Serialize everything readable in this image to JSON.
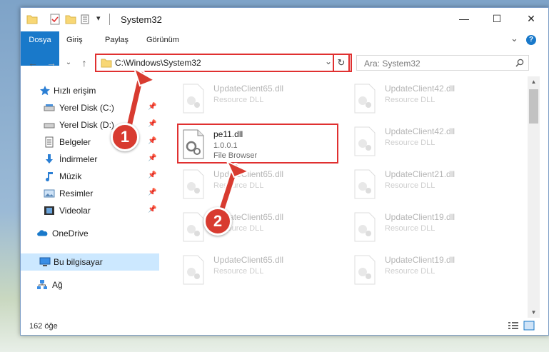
{
  "window": {
    "title": "System32",
    "quick_access_toolbar_arrow": "▾",
    "controls": {
      "minimize": "—",
      "maximize": "☐",
      "close": "✕"
    }
  },
  "ribbon": {
    "tabs": [
      "Dosya",
      "Giriş",
      "Paylaş",
      "Görünüm"
    ],
    "expand": "⌄",
    "help": "?"
  },
  "navigation": {
    "back": "←",
    "forward": "→",
    "recent": "⌄",
    "up": "↑",
    "address": "C:\\Windows\\System32",
    "address_dropdown": "⌄",
    "refresh": "↻",
    "search_placeholder": "Ara: System32"
  },
  "sidebar": {
    "items": [
      {
        "label": "Hızlı erişim",
        "icon": "star-icon",
        "pinned": false
      },
      {
        "label": "Yerel Disk (C:)",
        "icon": "drive-icon",
        "pinned": true
      },
      {
        "label": "Yerel Disk (D:)",
        "icon": "drive-icon",
        "pinned": true
      },
      {
        "label": "Belgeler",
        "icon": "documents-icon",
        "pinned": true
      },
      {
        "label": "İndirmeler",
        "icon": "downloads-icon",
        "pinned": true
      },
      {
        "label": "Müzik",
        "icon": "music-icon",
        "pinned": true
      },
      {
        "label": "Resimler",
        "icon": "pictures-icon",
        "pinned": true
      },
      {
        "label": "Videolar",
        "icon": "videos-icon",
        "pinned": true
      },
      {
        "label": "OneDrive",
        "icon": "cloud-icon",
        "pinned": false
      },
      {
        "label": "Bu bilgisayar",
        "icon": "computer-icon",
        "pinned": false,
        "selected": true
      },
      {
        "label": "Ağ",
        "icon": "network-icon",
        "pinned": false
      }
    ]
  },
  "files": {
    "highlighted": {
      "name": "pe11.dll",
      "version": "1.0.0.1",
      "description": "File Browser"
    },
    "left_column": [
      {
        "name": "UpdateClient65.dll",
        "description": "Resource DLL"
      },
      {
        "name": "UpdateClient65.dll",
        "description": "Resource DLL"
      },
      {
        "name": "UpdateClient65.dll",
        "description": "Resource DLL"
      },
      {
        "name": "UpdateClient65.dll",
        "description": "Resource DLL"
      }
    ],
    "right_column": [
      {
        "name": "UpdateClient42.dll",
        "description": "Resource DLL"
      },
      {
        "name": "UpdateClient42.dll",
        "description": "Resource DLL"
      },
      {
        "name": "UpdateClient21.dll",
        "description": "Resource DLL"
      },
      {
        "name": "UpdateClient19.dll",
        "description": "Resource DLL"
      },
      {
        "name": "UpdateClient19.dll",
        "description": "Resource DLL"
      }
    ]
  },
  "status": {
    "item_count": "162 öğe"
  },
  "annotations": {
    "step1": "1",
    "step2": "2",
    "accent_color": "#d83b30"
  }
}
